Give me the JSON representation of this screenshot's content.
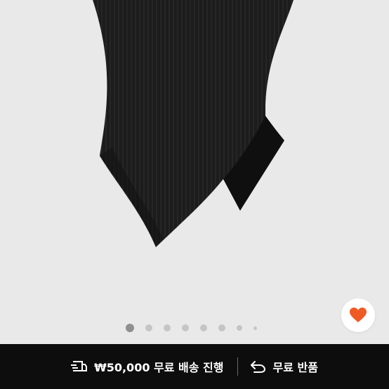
{
  "product": {
    "image_icon": "product-photo-black-ribbed-asymmetric-top",
    "carousel": {
      "total": 8,
      "active_index": 0
    }
  },
  "like": {
    "icon": "heart-icon",
    "color": "#ef5a24"
  },
  "bottom_bar": {
    "shipping_icon": "delivery-truck-icon",
    "shipping_text": "₩50,000 무료 배송 진행",
    "return_icon": "return-arrow-icon",
    "return_text": "무료 반품",
    "background": "#0d0d0d"
  }
}
